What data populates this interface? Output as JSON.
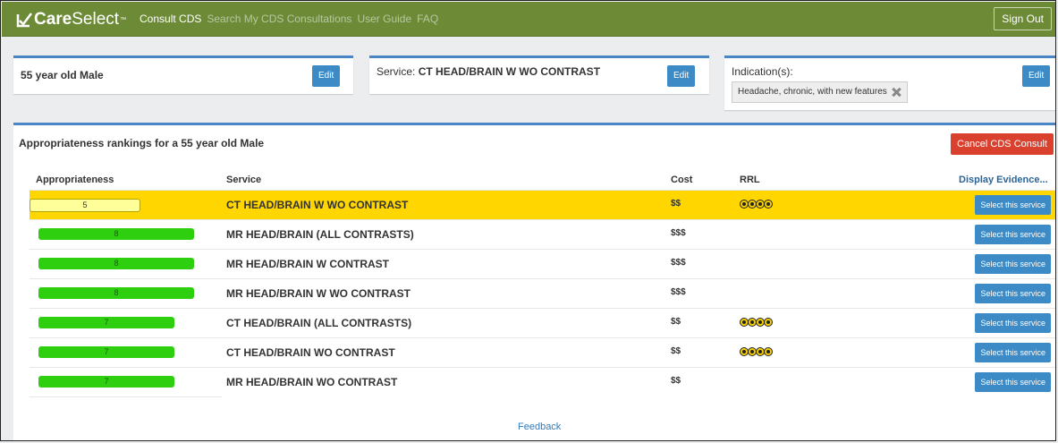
{
  "app": {
    "logo_care": "Care",
    "logo_select": "Select",
    "logo_tm": "™",
    "nav": [
      "Consult CDS",
      "Search My CDS Consultations",
      "User Guide",
      "FAQ"
    ],
    "sign_out": "Sign Out"
  },
  "patient": {
    "text": "55 year old Male",
    "edit": "Edit"
  },
  "service": {
    "label": "Service:",
    "value": "CT HEAD/BRAIN W WO CONTRAST",
    "edit": "Edit"
  },
  "indication": {
    "label": "Indication(s):",
    "tag": "Headache, chronic, with new features",
    "edit": "Edit"
  },
  "rankings": {
    "title": "Appropriateness rankings for a 55 year old Male",
    "cancel": "Cancel CDS Consult",
    "headers": {
      "appropriateness": "Appropriateness",
      "service": "Service",
      "cost": "Cost",
      "rrl": "RRL",
      "evidence": "Display Evidence..."
    },
    "select_label": "Select this service",
    "rows": [
      {
        "score": "5",
        "service": "CT HEAD/BRAIN W WO CONTRAST",
        "cost": "$$",
        "rrl": 4,
        "highlight": true,
        "color": "yellow"
      },
      {
        "score": "8",
        "service": "MR HEAD/BRAIN (ALL CONTRASTS)",
        "cost": "$$$",
        "rrl": 0,
        "highlight": false,
        "color": "green"
      },
      {
        "score": "8",
        "service": "MR HEAD/BRAIN W CONTRAST",
        "cost": "$$$",
        "rrl": 0,
        "highlight": false,
        "color": "green"
      },
      {
        "score": "8",
        "service": "MR HEAD/BRAIN W WO CONTRAST",
        "cost": "$$$",
        "rrl": 0,
        "highlight": false,
        "color": "green"
      },
      {
        "score": "7",
        "service": "CT HEAD/BRAIN (ALL CONTRASTS)",
        "cost": "$$",
        "rrl": 4,
        "highlight": false,
        "color": "green"
      },
      {
        "score": "7",
        "service": "CT HEAD/BRAIN WO CONTRAST",
        "cost": "$$",
        "rrl": 4,
        "highlight": false,
        "color": "green"
      },
      {
        "score": "7",
        "service": "MR HEAD/BRAIN WO CONTRAST",
        "cost": "$$",
        "rrl": 0,
        "highlight": false,
        "color": "green"
      }
    ],
    "feedback": "Feedback"
  },
  "colors": {
    "topbar": "#6d8b37",
    "accent": "#3d8bc6",
    "cancel": "#d9412e",
    "highlight": "#ffd600",
    "bar_green": "#2dcf0f"
  }
}
